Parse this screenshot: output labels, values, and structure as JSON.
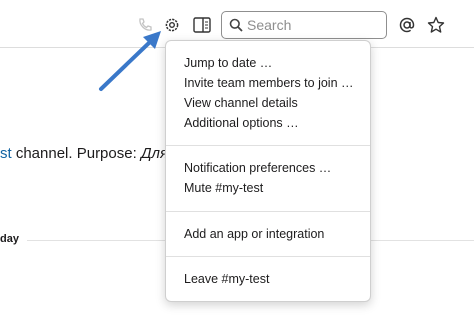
{
  "header": {
    "search_placeholder": "Search",
    "icons": [
      "phone-icon",
      "gear-icon",
      "details-panel-icon",
      "search-icon",
      "mentions-icon",
      "star-icon"
    ]
  },
  "channel_intro": {
    "link_fragment": "st",
    "text": " channel. Purpose: ",
    "purpose": "Для"
  },
  "day_divider": {
    "label": "day"
  },
  "menu": {
    "items": [
      "Jump to date …",
      "Invite team members to join …",
      "View channel details",
      "Additional options …",
      "Notification preferences …",
      "Mute #my-test",
      "Add an app or integration",
      "Leave #my-test"
    ]
  },
  "colors": {
    "link": "#1264a3",
    "arrow": "#3a78c9",
    "text": "#1d1c1d"
  }
}
